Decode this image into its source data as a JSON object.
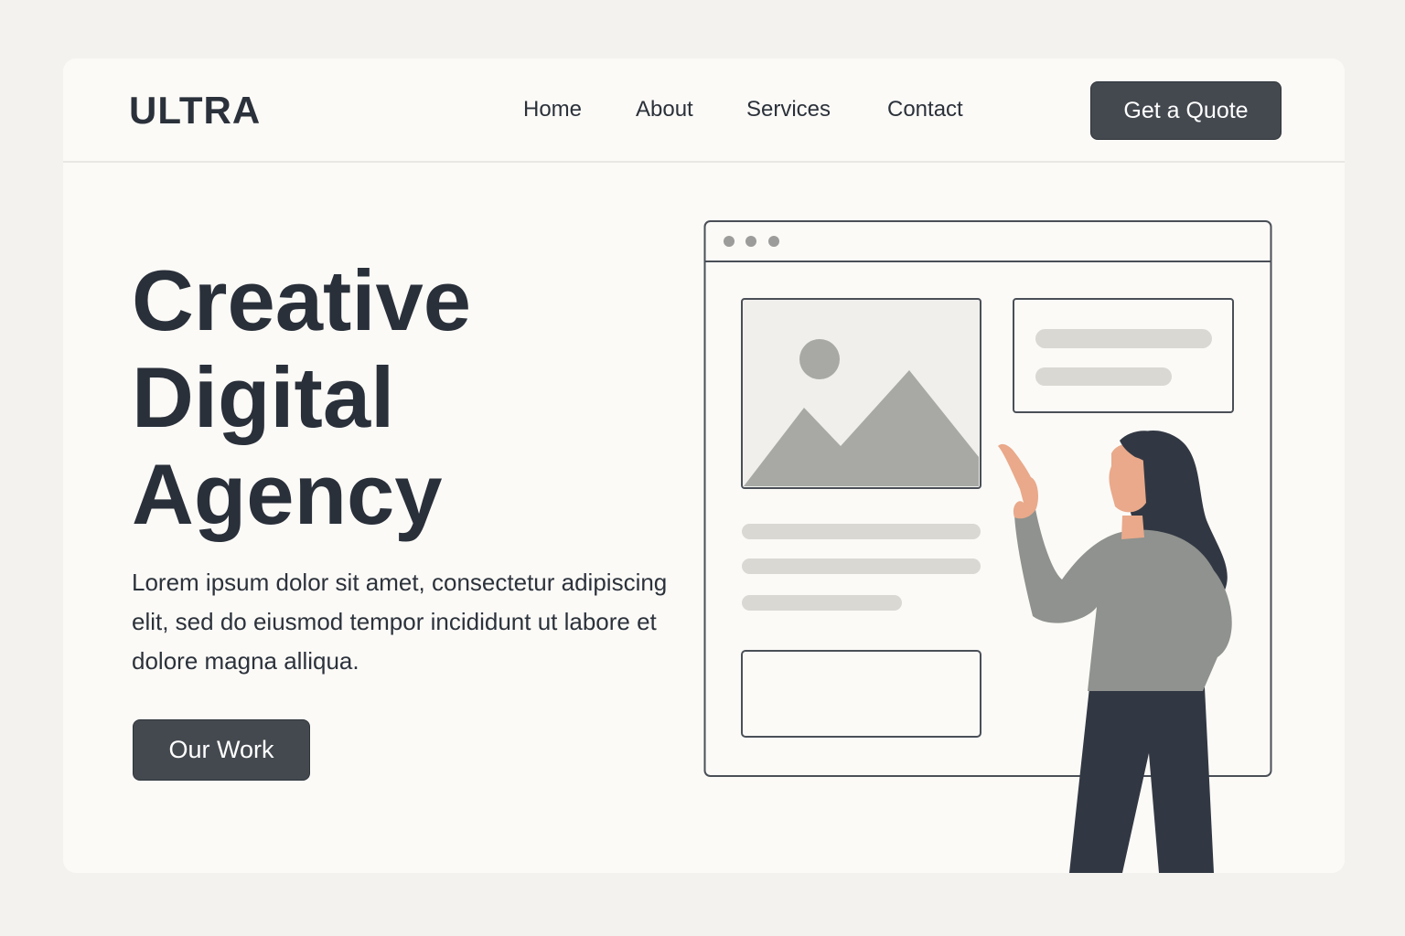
{
  "brand": {
    "logo_text": "ULTRA"
  },
  "nav": {
    "items": [
      {
        "label": "Home"
      },
      {
        "label": "About"
      },
      {
        "label": "Services"
      },
      {
        "label": "Contact"
      }
    ],
    "cta_label": "Get a Quote"
  },
  "hero": {
    "title_lines": [
      "Creative",
      "Digital",
      "Agency"
    ],
    "body": "Lorem ipsum dolor sit amet, consectetur adipiscing elit, sed do eiusmod tempor incididunt ut labore et dolore magna alliqua.",
    "cta_label": "Our Work"
  },
  "colors": {
    "page_background": "#f3f2ef",
    "card_background": "#fbfaf7",
    "dark_text": "#2a303a",
    "button": "#444950",
    "accent_skin": "#e9a98a"
  },
  "illustration": {
    "icons": [
      "browser-window-icon",
      "image-placeholder-icon",
      "person-pointing-icon"
    ]
  }
}
